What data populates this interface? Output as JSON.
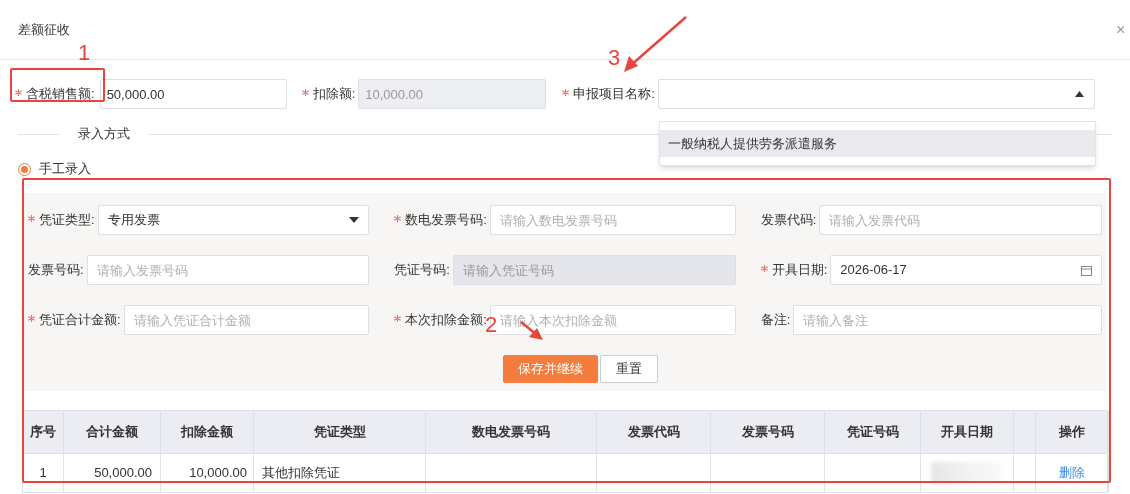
{
  "dialog": {
    "title": "差额征收",
    "close": "×"
  },
  "top_fields": [
    {
      "label": "含税销售额:",
      "required": true,
      "value": "50,000.00",
      "disabled": false
    },
    {
      "label": "扣除额:",
      "required": true,
      "value": "10,000.00",
      "disabled": true
    }
  ],
  "project_select": {
    "label": "申报项目名称:",
    "required": true,
    "expanded": true,
    "options": [
      {
        "label": "一般纳税人提供劳务派遣服务",
        "highlighted": true
      }
    ]
  },
  "entry_section": {
    "title": "录入方式",
    "options": [
      {
        "label": "手工录入",
        "selected": true
      }
    ]
  },
  "form_fields": [
    {
      "kind": "select",
      "label": "凭证类型:",
      "required": true,
      "value": "专用发票",
      "disabled": false
    },
    {
      "kind": "text",
      "label": "数电发票号码:",
      "required": true,
      "placeholder": "请输入数电发票号码",
      "disabled": false
    },
    {
      "kind": "text",
      "label": "发票代码:",
      "required": false,
      "placeholder": "请输入发票代码",
      "disabled": false
    },
    {
      "kind": "text",
      "label": "发票号码:",
      "required": false,
      "placeholder": "请输入发票号码",
      "disabled": false
    },
    {
      "kind": "text",
      "label": "凭证号码:",
      "required": false,
      "placeholder": "请输入凭证号码",
      "disabled": true
    },
    {
      "kind": "date",
      "label": "开具日期:",
      "required": true,
      "value": "2026-06-17",
      "disabled": false
    },
    {
      "kind": "text",
      "label": "凭证合计金额:",
      "required": true,
      "placeholder": "请输入凭证合计金额",
      "disabled": false
    },
    {
      "kind": "text",
      "label": "本次扣除金额:",
      "required": true,
      "placeholder": "请输入本次扣除金额",
      "disabled": false
    },
    {
      "kind": "text",
      "label": "备注:",
      "required": false,
      "placeholder": "请输入备注",
      "disabled": false
    }
  ],
  "buttons": [
    {
      "label": "保存并继续",
      "primary": true
    },
    {
      "label": "重置",
      "primary": false
    }
  ],
  "table": {
    "columns": [
      "序号",
      "合计金额",
      "扣除金额",
      "凭证类型",
      "数电发票号码",
      "发票代码",
      "发票号码",
      "凭证号码",
      "开具日期",
      "操作"
    ],
    "rows": [
      {
        "index": "1",
        "total": "50,000.00",
        "deducted": "10,000.00",
        "voucher_type": "其他扣除凭证",
        "date_redacted": true,
        "action": "删除"
      }
    ]
  },
  "annotations": [
    {
      "number": "1"
    },
    {
      "number": "2"
    },
    {
      "number": "3"
    }
  ]
}
